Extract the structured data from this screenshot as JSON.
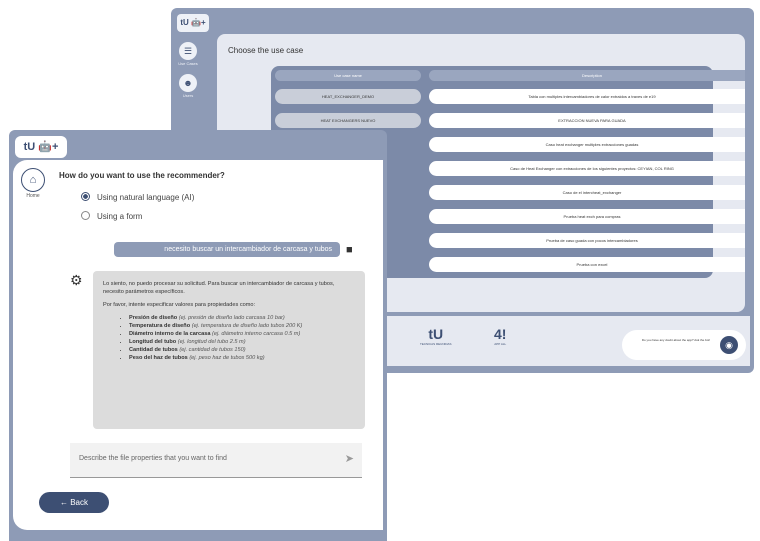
{
  "back_window": {
    "logo": "tU 🤖+",
    "sidebar": [
      {
        "label": "Use Cases",
        "icon": "list-icon"
      },
      {
        "label": "Users",
        "icon": "users-icon"
      }
    ],
    "title": "Choose the use case",
    "table": {
      "headers": {
        "name": "Use case name",
        "description": "Description"
      },
      "rows": [
        {
          "name": "HEAT_EXCHANGER_DEMO",
          "description": "Tabla con multiples intercambiadores de calor extraidos a traves de e19"
        },
        {
          "name": "HEAT EXCHANGERS NUEVO",
          "description": "EXTRACCION NUEVA PARA GUADA"
        },
        {
          "name": "",
          "description": "Caso heat exchanger multiples extracciones guadas"
        },
        {
          "name": "",
          "description": "Caso de Heat Exchanger con extracciones de los siguientes proyectos: CEYIAN, COL RING"
        },
        {
          "name": "",
          "description": "Caso de el intercheat_exchanger"
        },
        {
          "name": "",
          "description": "Prueba heat exch para compras"
        },
        {
          "name": "",
          "description": "Prueba de caso guada con pocos intercambiadores"
        },
        {
          "name": "",
          "description": "Prueba con excel"
        }
      ]
    },
    "footer": {
      "logo1": "tU",
      "logo1_caption": "TECNICAS REUNIDAS",
      "logo2": "4!",
      "logo2_caption": "APP ALL",
      "ask_text": "Do you have any doubt about the app? Ask the bot!"
    }
  },
  "front_window": {
    "logo": "tU 🤖+",
    "home_label": "Home",
    "question": "How do you want to use the recommender?",
    "options": [
      {
        "label": "Using natural language (AI)",
        "selected": true
      },
      {
        "label": "Using a form",
        "selected": false
      }
    ],
    "user_message": "necesito buscar un intercambiador de carcasa y tubos",
    "bot_message": {
      "intro": "Lo siento, no puedo procesar su solicitud. Para buscar un intercambiador de carcasa y tubos, necesito parámetros específicos.",
      "prompt": "Por favor, intente especificar valores para propiedades como:",
      "items": [
        {
          "name": "Presión de diseño",
          "example": "(ej. presión de diseño lado carcasa 10 bar)"
        },
        {
          "name": "Temperatura de diseño",
          "example": "(ej. temperatura de diseño lado tubos 200 K)"
        },
        {
          "name": "Diámetro interno de la carcasa",
          "example": "(ej. diámetro interno carcasa 0.5 m)"
        },
        {
          "name": "Longitud del tubo",
          "example": "(ej. longitud del tubo 2.5 m)"
        },
        {
          "name": "Cantidad de tubos",
          "example": "(ej. cantidad de tubos 150)"
        },
        {
          "name": "Peso del haz de tubos",
          "example": "(ej. peso haz de tubos 500 kg)"
        }
      ]
    },
    "input_placeholder": "Describe the file properties that you want to find",
    "back_label": "← Back"
  }
}
